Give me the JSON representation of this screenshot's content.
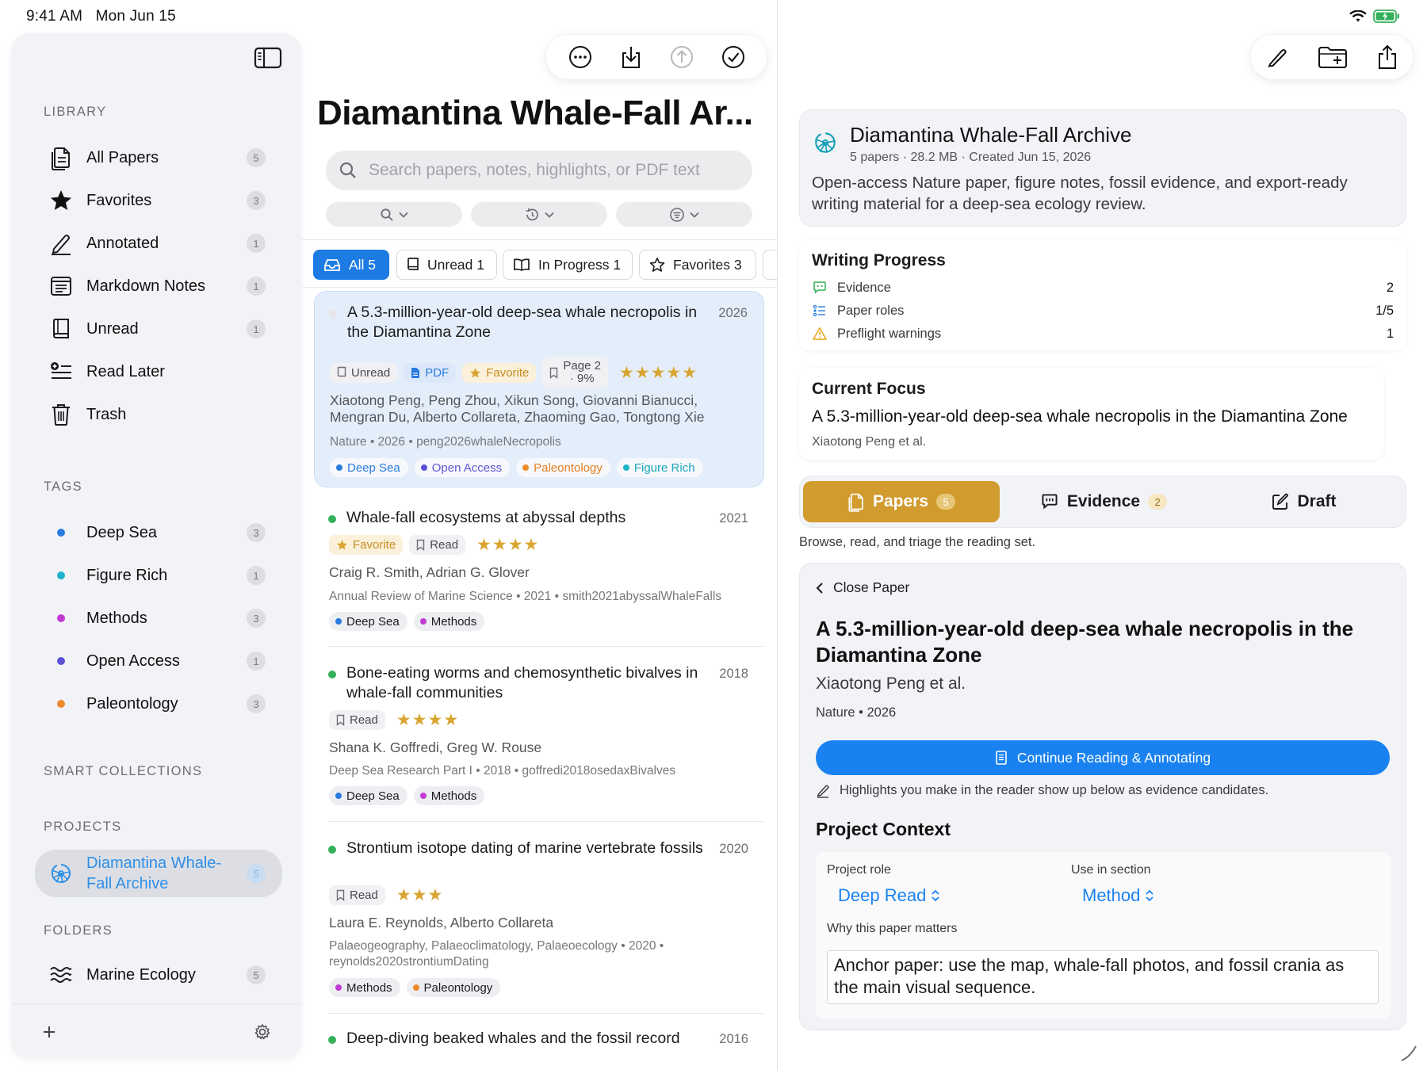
{
  "status_bar": {
    "time": "9:41 AM",
    "date": "Mon Jun 15"
  },
  "sidebar": {
    "library_title": "LIBRARY",
    "library_items": [
      {
        "label": "All Papers",
        "count": "5",
        "icon": "papers-icon"
      },
      {
        "label": "Favorites",
        "count": "3",
        "icon": "star-icon"
      },
      {
        "label": "Annotated",
        "count": "1",
        "icon": "pencil-icon"
      },
      {
        "label": "Markdown Notes",
        "count": "1",
        "icon": "note-icon"
      },
      {
        "label": "Unread",
        "count": "1",
        "icon": "book-icon"
      },
      {
        "label": "Read Later",
        "count": "",
        "icon": "read-later-icon"
      },
      {
        "label": "Trash",
        "count": "",
        "icon": "trash-icon"
      }
    ],
    "tags_title": "TAGS",
    "tags": [
      {
        "label": "Deep Sea",
        "count": "3",
        "color": "#2a7be0"
      },
      {
        "label": "Figure Rich",
        "count": "1",
        "color": "#1fb3c9"
      },
      {
        "label": "Methods",
        "count": "3",
        "color": "#c23bd4"
      },
      {
        "label": "Open Access",
        "count": "1",
        "color": "#5b4fd6"
      },
      {
        "label": "Paleontology",
        "count": "3",
        "color": "#ee8a2b"
      }
    ],
    "smart_title": "SMART COLLECTIONS",
    "projects_title": "PROJECTS",
    "project": {
      "line1": "Diamantina Whale-",
      "line2": "Fall Archive",
      "count": "5"
    },
    "folders_title": "FOLDERS",
    "folder": {
      "label": "Marine Ecology",
      "count": "5"
    }
  },
  "middle": {
    "title": "Diamantina Whale-Fall Ar...",
    "search_placeholder": "Search papers, notes, highlights, or PDF text",
    "segments": [
      {
        "label": "All 5"
      },
      {
        "label": "Unread 1"
      },
      {
        "label": "In Progress 1"
      },
      {
        "label": "Favorites 3"
      }
    ],
    "papers": [
      {
        "title": "A 5.3-million-year-old deep-sea whale necropolis in the Diamantina Zone",
        "year": "2026",
        "status": "Unread",
        "pdf": "PDF",
        "favorite": "Favorite",
        "page_line1": "Page 2",
        "page_line2": "· 9%",
        "stars": "★★★★★",
        "authors": "Xiaotong Peng, Peng Zhou, Xikun Song, Giovanni Bianucci, Mengran Du, Alberto Collareta, Zhaoming Gao, Tongtong Xie",
        "meta": "Nature • 2026 • peng2026whaleNecropolis",
        "tags": [
          "Deep Sea",
          "Open Access",
          "Paleontology",
          "Figure Rich"
        ]
      },
      {
        "title": "Whale-fall ecosystems at abyssal depths",
        "year": "2021",
        "favorite": "Favorite",
        "status": "Read",
        "stars": "★★★★",
        "authors": "Craig R. Smith, Adrian G. Glover",
        "meta": "Annual Review of Marine Science • 2021 • smith2021abyssalWhaleFalls",
        "tags": [
          "Deep Sea",
          "Methods"
        ]
      },
      {
        "title": "Bone-eating worms and chemosynthetic bivalves in whale-fall communities",
        "year": "2018",
        "status": "Read",
        "stars": "★★★★",
        "authors": "Shana K. Goffredi, Greg W. Rouse",
        "meta": "Deep Sea Research Part I • 2018 • goffredi2018osedaxBivalves",
        "tags": [
          "Deep Sea",
          "Methods"
        ]
      },
      {
        "title": "Strontium isotope dating of marine vertebrate fossils",
        "year": "2020",
        "status": "Read",
        "stars": "★★★",
        "authors": "Laura E. Reynolds, Alberto Collareta",
        "meta": "Palaeogeography, Palaeoclimatology, Palaeoecology • 2020 • reynolds2020strontiumDating",
        "tags": [
          "Methods",
          "Paleontology"
        ]
      },
      {
        "title": "Deep-diving beaked whales and the fossil record",
        "year": "2016"
      }
    ]
  },
  "detail": {
    "project_title": "Diamantina Whale-Fall Archive",
    "project_meta": "5 papers · 28.2 MB · Created Jun 15, 2026",
    "project_desc": "Open-access Nature paper, figure notes, fossil evidence, and export-ready writing material for a deep-sea ecology review.",
    "writing_progress_title": "Writing Progress",
    "progress": [
      {
        "label": "Evidence",
        "value": "2"
      },
      {
        "label": "Paper roles",
        "value": "1/5"
      },
      {
        "label": "Preflight warnings",
        "value": "1"
      }
    ],
    "current_focus_title": "Current Focus",
    "current_focus_paper": "A 5.3-million-year-old deep-sea whale necropolis in the Diamantina Zone",
    "current_focus_authors": "Xiaotong Peng et al.",
    "tabs": [
      {
        "label": "Papers",
        "count": "5"
      },
      {
        "label": "Evidence",
        "count": "2"
      },
      {
        "label": "Draft",
        "count": ""
      }
    ],
    "tab_hint": "Browse, read, and triage the reading set.",
    "close_paper": "Close Paper",
    "paper_title": "A 5.3-million-year-old deep-sea whale necropolis in the Diamantina Zone",
    "paper_authors": "Xiaotong Peng et al.",
    "paper_meta": "Nature • 2026",
    "cta_label": "Continue Reading & Annotating",
    "highlight_hint": "Highlights you make in the reader show up below as evidence candidates.",
    "project_context_title": "Project Context",
    "project_role_label": "Project role",
    "project_role_value": "Deep Read",
    "use_in_section_label": "Use in section",
    "use_in_section_value": "Method",
    "why_label": "Why this paper matters",
    "why_text": "Anchor paper: use the map, whale-fall photos, and fossil crania as the main visual sequence."
  },
  "colors": {
    "accent_blue": "#1a82f0",
    "gold": "#d19b2d",
    "status_green": "#34b05a"
  }
}
